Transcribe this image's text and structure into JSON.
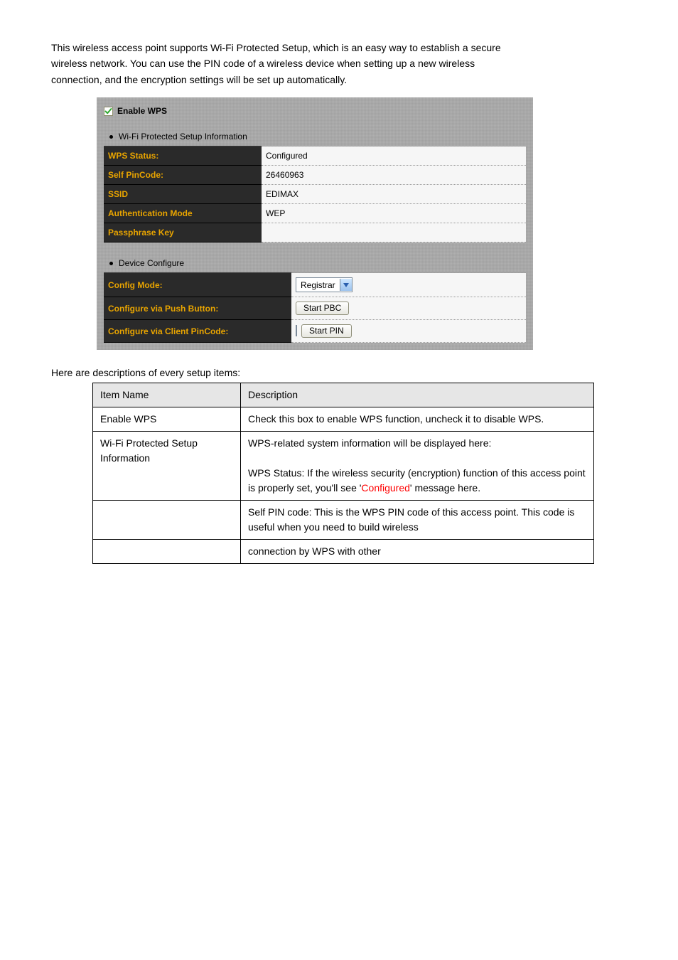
{
  "intro_para": "This wireless access point supports Wi-Fi Protected Setup, which is an easy way to establish a secure wireless network. You can use the PIN code of a wireless device when setting up a new wireless connection, and the encryption settings will be set up automatically.",
  "enable_label": "Enable WPS",
  "section1_title": "Wi-Fi Protected Setup Information",
  "section2_title": "Device Configure",
  "info_rows": [
    {
      "label": "WPS Status:",
      "value": "Configured"
    },
    {
      "label": "Self PinCode:",
      "value": "26460963"
    },
    {
      "label": "SSID",
      "value": "EDIMAX"
    },
    {
      "label": "Authentication Mode",
      "value": "WEP"
    },
    {
      "label": "Passphrase Key",
      "value": ""
    }
  ],
  "cfg": {
    "config_mode_label": "Config Mode:",
    "config_mode_value": "Registrar",
    "push_button_label": "Configure via Push Button:",
    "push_button_btn": "Start PBC",
    "client_pin_label": "Configure via Client PinCode:",
    "client_pin_btn": "Start PIN"
  },
  "desc_intro": "Here are descriptions of every setup items:",
  "desc_header": {
    "c1": "Item Name",
    "c2": "Description"
  },
  "desc_rows": [
    {
      "name": "Enable WPS",
      "desc": "Check this box to enable WPS function, uncheck it to disable WPS."
    },
    {
      "name": "Wi-Fi Protected Setup Information",
      "desc_html": "WPS-related system information will be displayed here:<br><br>WPS Status: If the wireless security (encryption) function of this access point is properly set, you'll see '<span class=\"note-red\">Configured</span>' message here."
    },
    {
      "name": "",
      "desc": "Self PIN code: This is the WPS PIN code of this access point. This code is useful when you need to build wireless"
    },
    {
      "name": "",
      "desc": "connection by WPS with other"
    }
  ]
}
